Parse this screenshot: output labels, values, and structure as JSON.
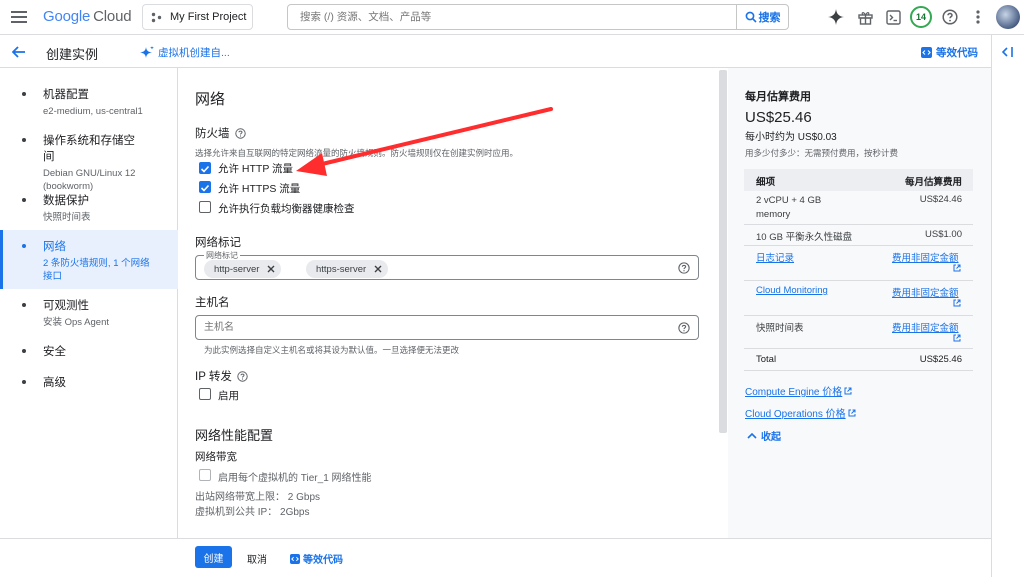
{
  "topbar": {
    "brand_google": "Google",
    "brand_cloud": "Cloud",
    "project": "My First Project",
    "search_placeholder": "搜索 (/) 资源、文档、产品等",
    "search_button": "搜索",
    "notification_count": "14"
  },
  "page": {
    "title": "创建实例",
    "assistant_link": "虚拟机创建自...",
    "equivalent_code": "等效代码"
  },
  "nav": [
    {
      "title": "机器配置",
      "sub": "e2-medium, us-central1"
    },
    {
      "title": "操作系统和存储空间",
      "sub": "Debian GNU/Linux 12 (bookworm)"
    },
    {
      "title": "数据保护",
      "sub": "快照时间表"
    },
    {
      "title": "网络",
      "sub": "2 条防火墙规则, 1 个网络接口"
    },
    {
      "title": "可观测性",
      "sub": "安装 Ops Agent"
    },
    {
      "title": "安全",
      "sub": ""
    },
    {
      "title": "高级",
      "sub": ""
    }
  ],
  "network": {
    "heading": "网络",
    "firewall": {
      "title": "防火墙",
      "desc": "选择允许来自互联网的特定网络流量的防火墙规则。防火墙规则仅在创建实例时应用。",
      "options": [
        {
          "label": "允许 HTTP 流量",
          "checked": true
        },
        {
          "label": "允许 HTTPS 流量",
          "checked": true
        },
        {
          "label": "允许执行负载均衡器健康检查",
          "checked": false
        }
      ]
    },
    "tags": {
      "title": "网络标记",
      "float_label": "网络标记",
      "chips": [
        "http-server",
        "https-server"
      ]
    },
    "hostname": {
      "title": "主机名",
      "placeholder": "主机名",
      "hint": "为此实例选择自定义主机名或将其设为默认值。一旦选择便无法更改"
    },
    "ip_forwarding": {
      "title": "IP 转发",
      "enable_label": "启用"
    },
    "perf": {
      "heading": "网络性能配置",
      "bandwidth_title": "网络带宽",
      "tier1_label": "启用每个虚拟机的 Tier_1 网络性能",
      "egress_limit": "出站网络带宽上限： 2 Gbps",
      "public_ip": "虚拟机到公共 IP： 2Gbps"
    }
  },
  "cost": {
    "title": "每月估算费用",
    "amount": "US$25.46",
    "hourly": "每小时约为 US$0.03",
    "note": "用多少付多少：无需预付费用，按秒计费",
    "table_header": {
      "item": "细项",
      "monthly": "每月估算费用"
    },
    "rows": [
      {
        "item": "2 vCPU + 4 GB memory",
        "value": "US$24.46"
      },
      {
        "item": "10 GB 平衡永久性磁盘",
        "value": "US$1.00"
      },
      {
        "item": "日志记录",
        "value": "费用非固定金额"
      },
      {
        "item": "Cloud Monitoring",
        "value": "费用非固定金额"
      },
      {
        "item": "快照时间表",
        "value": "费用非固定金额"
      }
    ],
    "total_label": "Total",
    "total_value": "US$25.46",
    "links": [
      "Compute Engine 价格",
      "Cloud Operations 价格"
    ],
    "collapse": "收起"
  },
  "footer": {
    "create": "创建",
    "cancel": "取消",
    "equivalent_code": "等效代码"
  },
  "colors": {
    "primary": "#1a73e8",
    "annotation_arrow": "#ff2d2d"
  }
}
